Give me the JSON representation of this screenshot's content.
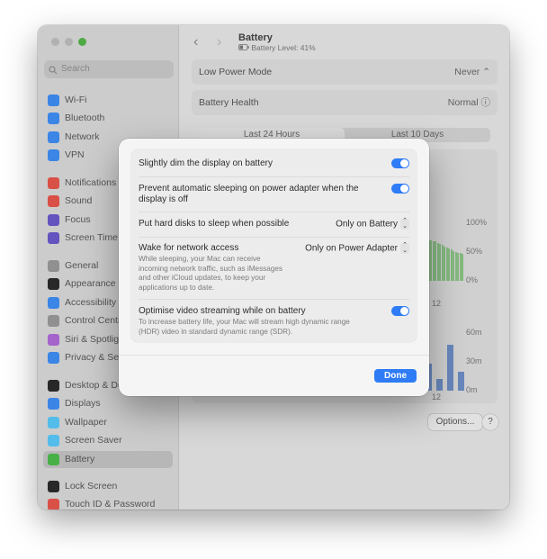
{
  "sidebar": {
    "search_placeholder": "Search",
    "items": [
      {
        "label": "Wi-Fi",
        "icon": "wifi-icon",
        "color": "#3f8ef5"
      },
      {
        "label": "Bluetooth",
        "icon": "bluetooth-icon",
        "color": "#3f8ef5"
      },
      {
        "label": "Network",
        "icon": "globe-icon",
        "color": "#3f8ef5"
      },
      {
        "label": "VPN",
        "icon": "vpn-icon",
        "color": "#3f8ef5"
      },
      {
        "label": "Notifications",
        "icon": "bell-icon",
        "color": "#e7554c"
      },
      {
        "label": "Sound",
        "icon": "speaker-icon",
        "color": "#e7554c"
      },
      {
        "label": "Focus",
        "icon": "moon-icon",
        "color": "#6a5acd"
      },
      {
        "label": "Screen Time",
        "icon": "hourglass-icon",
        "color": "#6a5acd"
      },
      {
        "label": "General",
        "icon": "gear-icon",
        "color": "#9a9a9a"
      },
      {
        "label": "Appearance",
        "icon": "appearance-icon",
        "color": "#2b2b2b"
      },
      {
        "label": "Accessibility",
        "icon": "accessibility-icon",
        "color": "#3f8ef5"
      },
      {
        "label": "Control Centre",
        "icon": "control-centre-icon",
        "color": "#9a9a9a"
      },
      {
        "label": "Siri & Spotlight",
        "icon": "siri-icon",
        "color": "#b06ad9"
      },
      {
        "label": "Privacy & Security",
        "icon": "hand-icon",
        "color": "#3f8ef5"
      },
      {
        "label": "Desktop & Dock",
        "icon": "dock-icon",
        "color": "#2b2b2b"
      },
      {
        "label": "Displays",
        "icon": "display-icon",
        "color": "#3f8ef5"
      },
      {
        "label": "Wallpaper",
        "icon": "wallpaper-icon",
        "color": "#5ac8fa"
      },
      {
        "label": "Screen Saver",
        "icon": "screensaver-icon",
        "color": "#5ac8fa"
      },
      {
        "label": "Battery",
        "icon": "battery-icon",
        "color": "#4cbb4c"
      },
      {
        "label": "Lock Screen",
        "icon": "lock-icon",
        "color": "#2b2b2b"
      },
      {
        "label": "Touch ID & Password",
        "icon": "fingerprint-icon",
        "color": "#e7554c"
      }
    ]
  },
  "header": {
    "title": "Battery",
    "subtitle": "Battery Level: 41%"
  },
  "settings": {
    "low_power_label": "Low Power Mode",
    "low_power_value": "Never",
    "battery_health_label": "Battery Health",
    "battery_health_value": "Normal"
  },
  "tabs": [
    "Last 24 Hours",
    "Last 10 Days"
  ],
  "chart_axes": {
    "level_ticks": [
      "100%",
      "50%",
      "0%"
    ],
    "time_ticks": [
      "60m",
      "30m",
      "0m"
    ],
    "x_tick": "12"
  },
  "chart_data": [
    {
      "type": "bar",
      "ylabel": "",
      "ylim": [
        0,
        100
      ],
      "y_ticks": [
        "100%",
        "50%",
        "0%"
      ],
      "x_tick_visible": "12",
      "visible_values_pct": [
        72,
        71,
        70,
        69,
        68,
        66,
        64,
        62,
        60,
        58,
        56,
        54,
        52,
        50,
        49,
        48,
        47
      ]
    },
    {
      "type": "bar",
      "ylabel": "",
      "ylim": [
        0,
        60
      ],
      "y_ticks": [
        "60m",
        "30m",
        "0m"
      ],
      "x_tick_visible": "12",
      "visible_values_min": [
        28,
        12,
        48,
        20
      ]
    }
  ],
  "buttons": {
    "options": "Options...",
    "help": "?"
  },
  "dialog": {
    "rows": [
      {
        "label": "Slightly dim the display on battery",
        "control": "toggle",
        "on": true
      },
      {
        "label": "Prevent automatic sleeping on power adapter when the display is off",
        "control": "toggle",
        "on": true
      },
      {
        "label": "Put hard disks to sleep when possible",
        "control": "popup",
        "value": "Only on Battery"
      },
      {
        "label": "Wake for network access",
        "desc": "While sleeping, your Mac can receive incoming network traffic, such as iMessages and other iCloud updates, to keep your applications up to date.",
        "control": "popup",
        "value": "Only on Power Adapter"
      },
      {
        "label": "Optimise video streaming while on battery",
        "desc": "To increase battery life, your Mac will stream high dynamic range (HDR) video in standard dynamic range (SDR).",
        "control": "toggle",
        "on": true
      }
    ],
    "done_label": "Done"
  },
  "colors": {
    "accent": "#2f7cf6",
    "battery_green": "#8fc58a",
    "usage_blue": "#6f90c8"
  }
}
